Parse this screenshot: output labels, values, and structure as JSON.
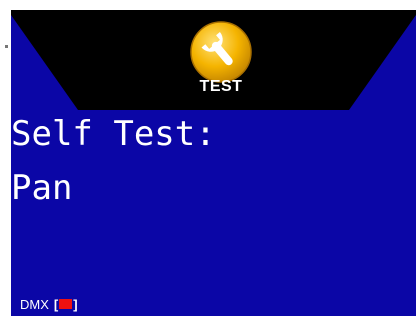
{
  "header": {
    "mode_icon": "wrench-icon",
    "mode_label": "TEST"
  },
  "main": {
    "line1": "Self Test:",
    "line2": "Pan"
  },
  "status": {
    "dmx_label": "DMX",
    "bracket_open": "[",
    "bracket_close": "]",
    "dmx_indicator_color": "#ee1111"
  },
  "colors": {
    "background": "#0b06a6",
    "header_band": "#000000",
    "icon_fill": "#f5b400",
    "text": "#ffffff"
  }
}
